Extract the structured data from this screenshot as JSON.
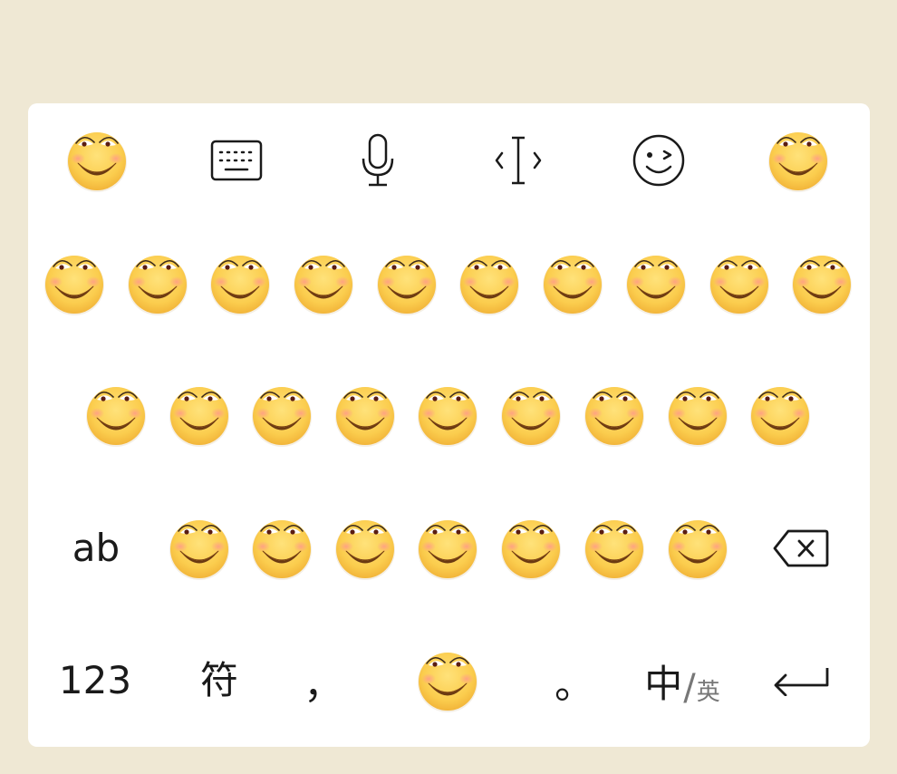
{
  "keyboard": {
    "toolbar": {
      "left_emoji": "smile-emoji",
      "keyboard_icon": "keyboard-icon",
      "mic_icon": "microphone-icon",
      "cursor_icon": "cursor-move-icon",
      "emoji_icon": "wink-face-icon",
      "right_emoji": "smile-emoji"
    },
    "row1": [
      "smile-emoji",
      "smile-emoji",
      "smile-emoji",
      "smile-emoji",
      "smile-emoji",
      "smile-emoji",
      "smile-emoji",
      "smile-emoji",
      "smile-emoji",
      "smile-emoji"
    ],
    "row2": [
      "smile-emoji",
      "smile-emoji",
      "smile-emoji",
      "smile-emoji",
      "smile-emoji",
      "smile-emoji",
      "smile-emoji",
      "smile-emoji",
      "smile-emoji"
    ],
    "row3": {
      "mode_key": "ab",
      "emojis": [
        "smile-emoji",
        "smile-emoji",
        "smile-emoji",
        "smile-emoji",
        "smile-emoji",
        "smile-emoji",
        "smile-emoji"
      ],
      "backspace_icon": "backspace-icon"
    },
    "row4": {
      "numbers_key": "123",
      "symbols_key": "符",
      "comma_key": "，",
      "space_emoji": "smile-emoji",
      "period_key": "。",
      "lang_key_main": "中",
      "lang_key_slash": "/",
      "lang_key_alt": "英",
      "enter_icon": "enter-icon"
    }
  }
}
